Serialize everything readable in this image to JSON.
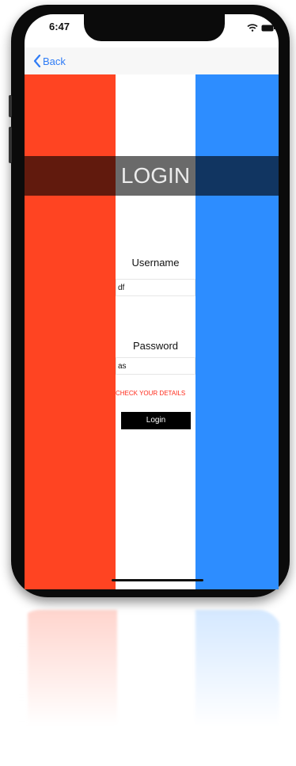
{
  "status_bar": {
    "time": "6:47"
  },
  "nav": {
    "back_label": "Back"
  },
  "title": "LOGIN",
  "form": {
    "username_label": "Username",
    "username_value": "df",
    "password_label": "Password",
    "password_value": "as",
    "error_message": "CHECK YOUR DETAILS",
    "login_button_label": "Login"
  },
  "colors": {
    "red": "#ff4422",
    "blue": "#2d8dff",
    "accent": "#2f7cf6",
    "error": "#ff2a1a"
  },
  "icons": [
    "chevron-left-icon",
    "wifi-icon",
    "battery-icon"
  ]
}
